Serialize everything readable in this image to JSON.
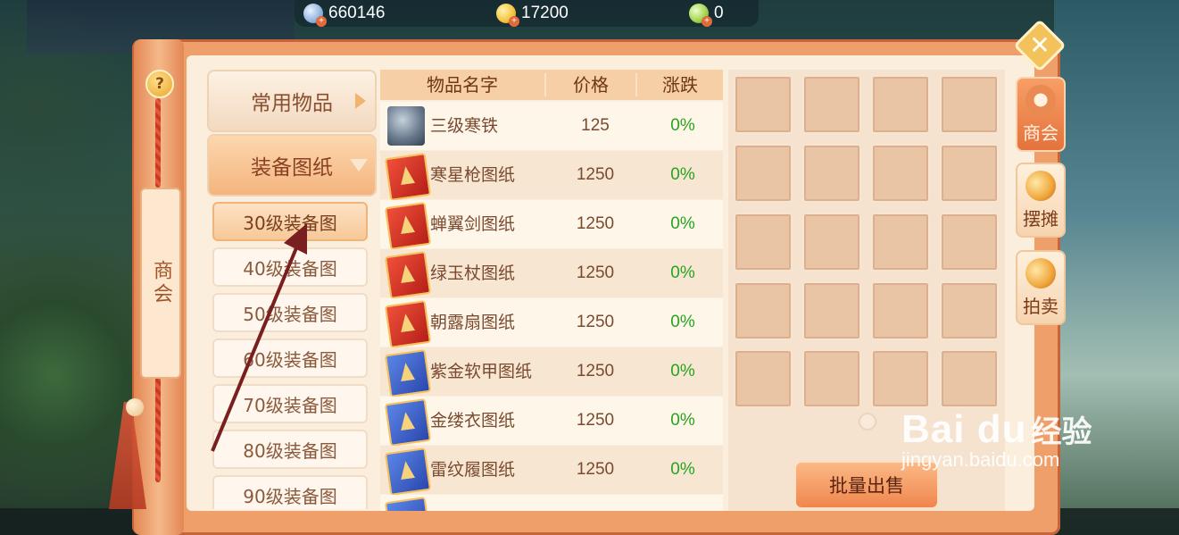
{
  "currencies": [
    {
      "icon": "silver-coin-icon",
      "value": "660146"
    },
    {
      "icon": "gold-coin-icon",
      "value": "17200"
    },
    {
      "icon": "jade-icon",
      "value": "0"
    }
  ],
  "side_panel": {
    "title": "商会",
    "help_label": "?"
  },
  "categories": {
    "common_items": "常用物品",
    "equipment_blueprints": "装备图纸",
    "sub_items": [
      "30级装备图",
      "40级装备图",
      "50级装备图",
      "60级装备图",
      "70级装备图",
      "80级装备图",
      "90级装备图"
    ]
  },
  "table": {
    "headers": {
      "name": "物品名字",
      "price": "价格",
      "change": "涨跌"
    },
    "rows": [
      {
        "name": "三级寒铁",
        "price": "125",
        "change": "0%",
        "icon": "iron-ore-icon"
      },
      {
        "name": "寒星枪图纸",
        "price": "1250",
        "change": "0%",
        "icon": "red-blueprint-icon"
      },
      {
        "name": "蝉翼剑图纸",
        "price": "1250",
        "change": "0%",
        "icon": "red-blueprint-icon"
      },
      {
        "name": "绿玉杖图纸",
        "price": "1250",
        "change": "0%",
        "icon": "red-blueprint-icon"
      },
      {
        "name": "朝露扇图纸",
        "price": "1250",
        "change": "0%",
        "icon": "red-blueprint-icon"
      },
      {
        "name": "紫金软甲图纸",
        "price": "1250",
        "change": "0%",
        "icon": "blue-blueprint-icon"
      },
      {
        "name": "金缕衣图纸",
        "price": "1250",
        "change": "0%",
        "icon": "blue-blueprint-icon"
      },
      {
        "name": "雷纹履图纸",
        "price": "1250",
        "change": "0%",
        "icon": "blue-blueprint-icon"
      }
    ]
  },
  "bulk_sell_label": "批量出售",
  "right_tabs": {
    "guild": "商会",
    "stall": "摆摊",
    "auction": "拍卖"
  },
  "colors": {
    "change_positive": "#27a31f",
    "frame": "#ef9f6a"
  },
  "watermark": {
    "logo": "Bai du",
    "brand_cn": "经验",
    "url": "jingyan.baidu.com"
  }
}
